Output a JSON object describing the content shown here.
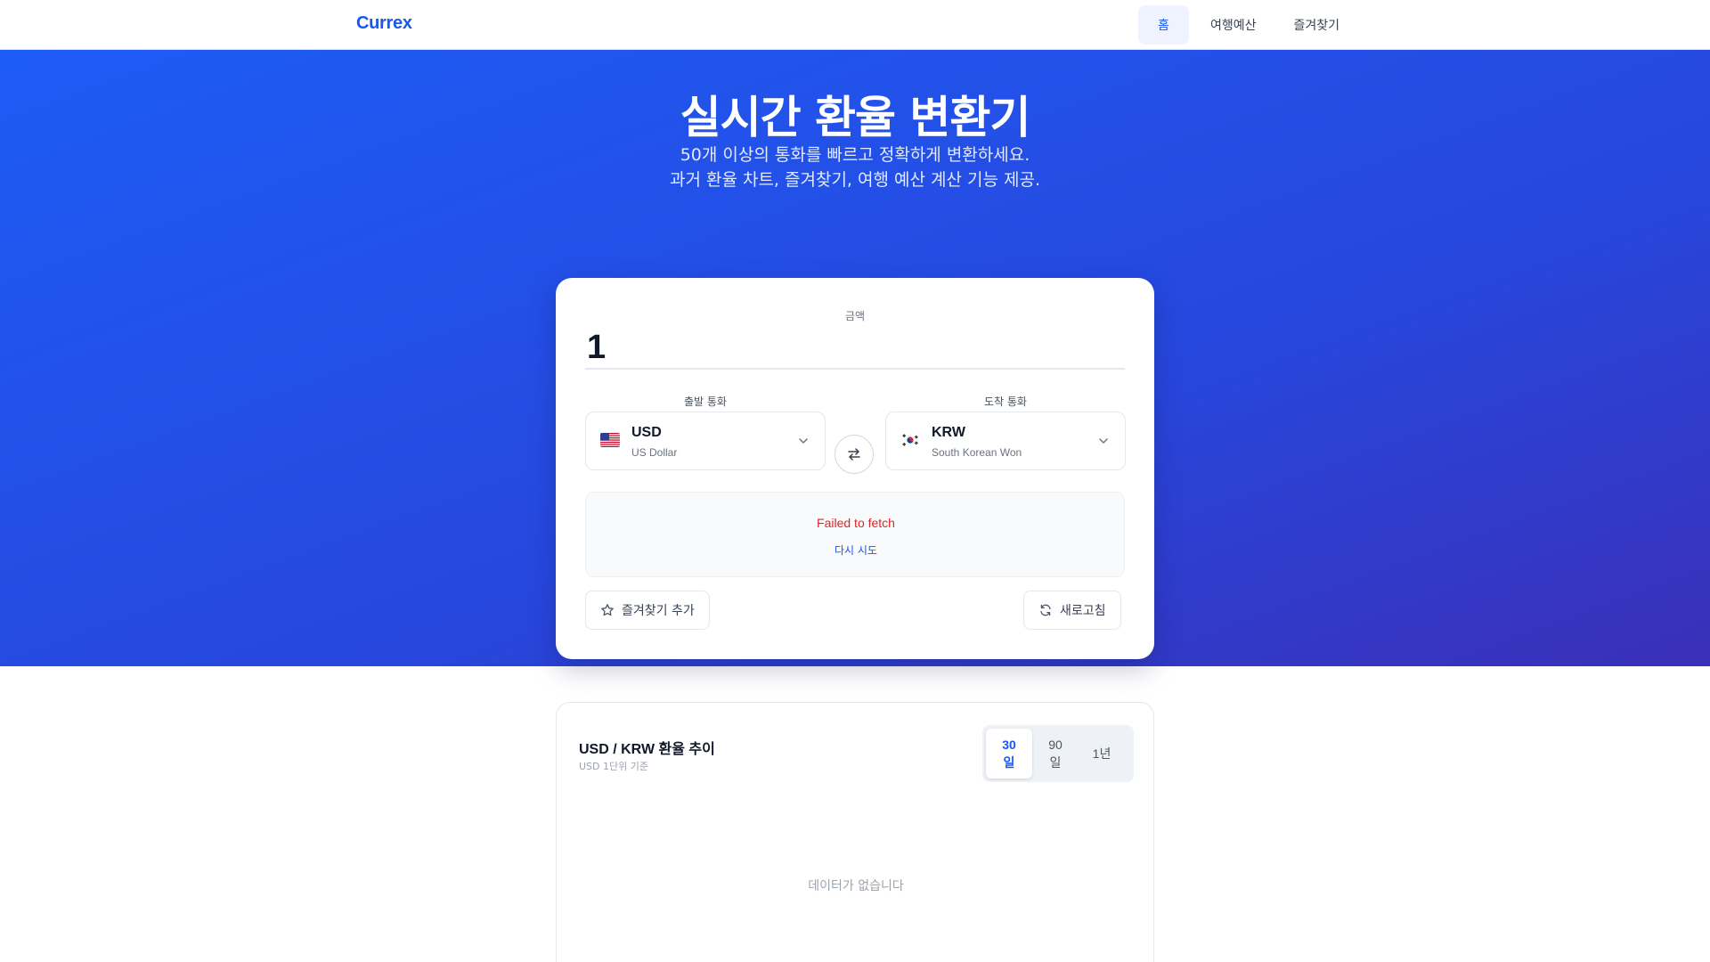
{
  "brand": "Currex",
  "nav": {
    "items": [
      {
        "label": "홈",
        "active": true
      },
      {
        "label": "여행예산",
        "active": false
      },
      {
        "label": "즐겨찾기",
        "active": false
      }
    ]
  },
  "hero": {
    "title": "실시간 환율 변환기",
    "subtitle_line1": "50개 이상의 통화를 빠르고 정확하게 변환하세요.",
    "subtitle_line2": "과거 환율 차트, 즐겨찾기, 여행 예산 계산 기능 제공."
  },
  "converter": {
    "amount_label": "금액",
    "amount_value": "1",
    "from": {
      "label": "출발 통화",
      "code": "USD",
      "name": "US Dollar",
      "flag": "us-flag-icon"
    },
    "to": {
      "label": "도착 통화",
      "code": "KRW",
      "name": "South Korean Won",
      "flag": "kr-flag-icon"
    },
    "error_text": "Failed to fetch",
    "retry_label": "다시 시도",
    "favorite_label": "즐겨찾기 추가",
    "refresh_label": "새로고침"
  },
  "chart": {
    "title": "USD / KRW 환율 추이",
    "subtitle": "USD 1단위 기준",
    "ranges": [
      {
        "label": "30일",
        "active": true
      },
      {
        "label": "90일",
        "active": false
      },
      {
        "label": "1년",
        "active": false
      }
    ],
    "empty_text": "데이터가 없습니다"
  },
  "colors": {
    "accent": "#1a56f0",
    "error": "#dc2626",
    "hero_gradient_start": "#1d5cf5",
    "hero_gradient_end": "#3a2fb8"
  }
}
